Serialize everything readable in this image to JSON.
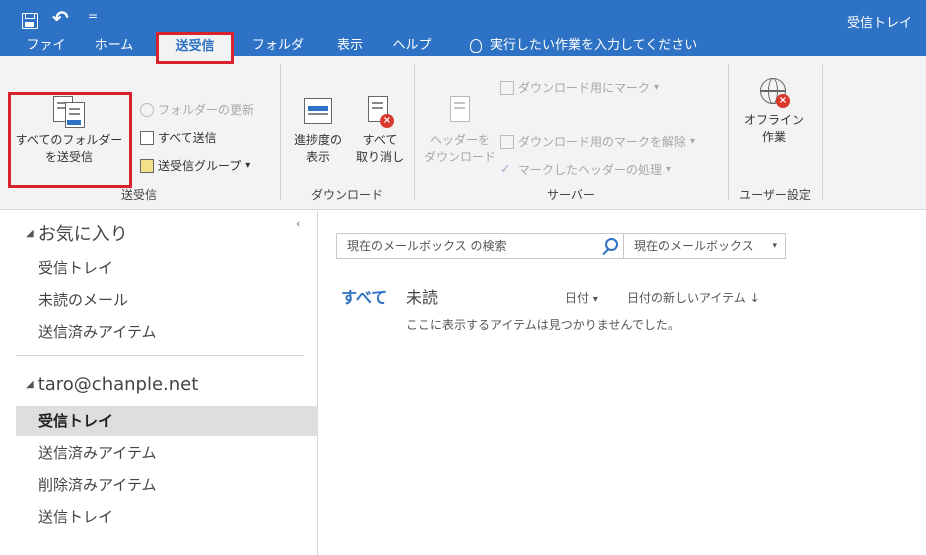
{
  "window": {
    "title": "受信トレイ"
  },
  "qat": {
    "undo_glyph": "↶",
    "more_glyph": "="
  },
  "tabs": [
    {
      "label": "ファイル"
    },
    {
      "label": "ホーム"
    },
    {
      "label": "送受信"
    },
    {
      "label": "フォルダー"
    },
    {
      "label": "表示"
    },
    {
      "label": "ヘルプ"
    }
  ],
  "tell_me": {
    "placeholder": "実行したい作業を入力してください"
  },
  "ribbon": {
    "send_receive_group": {
      "label": "送受信",
      "send_receive_all": "すべてのフォルダー\nを送受信",
      "send_receive_all_line1": "すべてのフォルダー",
      "send_receive_all_line2": "を送受信",
      "update_folder": "フォルダーの更新",
      "send_all": "すべて送信",
      "send_receive_groups": "送受信グループ"
    },
    "download_group": {
      "label": "ダウンロード",
      "show_progress_line1": "進捗度の",
      "show_progress_line2": "表示",
      "cancel_all_line1": "すべて",
      "cancel_all_line2": "取り消し"
    },
    "server_group": {
      "label": "サーバー",
      "download_headers_line1": "ヘッダーを",
      "download_headers_line2": "ダウンロード",
      "mark_download": "ダウンロード用にマーク",
      "unmark_download": "ダウンロード用のマークを解除",
      "process_marked": "マークしたヘッダーの処理"
    },
    "preferences_group": {
      "label": "ユーザー設定",
      "work_offline_line1": "オフライン",
      "work_offline_line2": "作業"
    },
    "dropdown_glyph": "▾"
  },
  "nav": {
    "collapse_glyph": "‹",
    "favorites": {
      "label": "お気に入り",
      "items": [
        "受信トレイ",
        "未読のメール",
        "送信済みアイテム"
      ]
    },
    "account": {
      "label": "taro@chanple.net",
      "items": [
        "受信トレイ",
        "送信済みアイテム",
        "削除済みアイテム",
        "送信トレイ"
      ]
    },
    "expand_glyph": "◢"
  },
  "main": {
    "search": {
      "placeholder": "現在のメールボックス の検索"
    },
    "scope": {
      "value": "現在のメールボックス"
    },
    "filters": {
      "all": "すべて",
      "unread": "未読"
    },
    "sort": {
      "by": "日付",
      "order": "日付の新しいアイテム ↓"
    },
    "empty_message": "ここに表示するアイテムは見つかりませんでした。"
  }
}
